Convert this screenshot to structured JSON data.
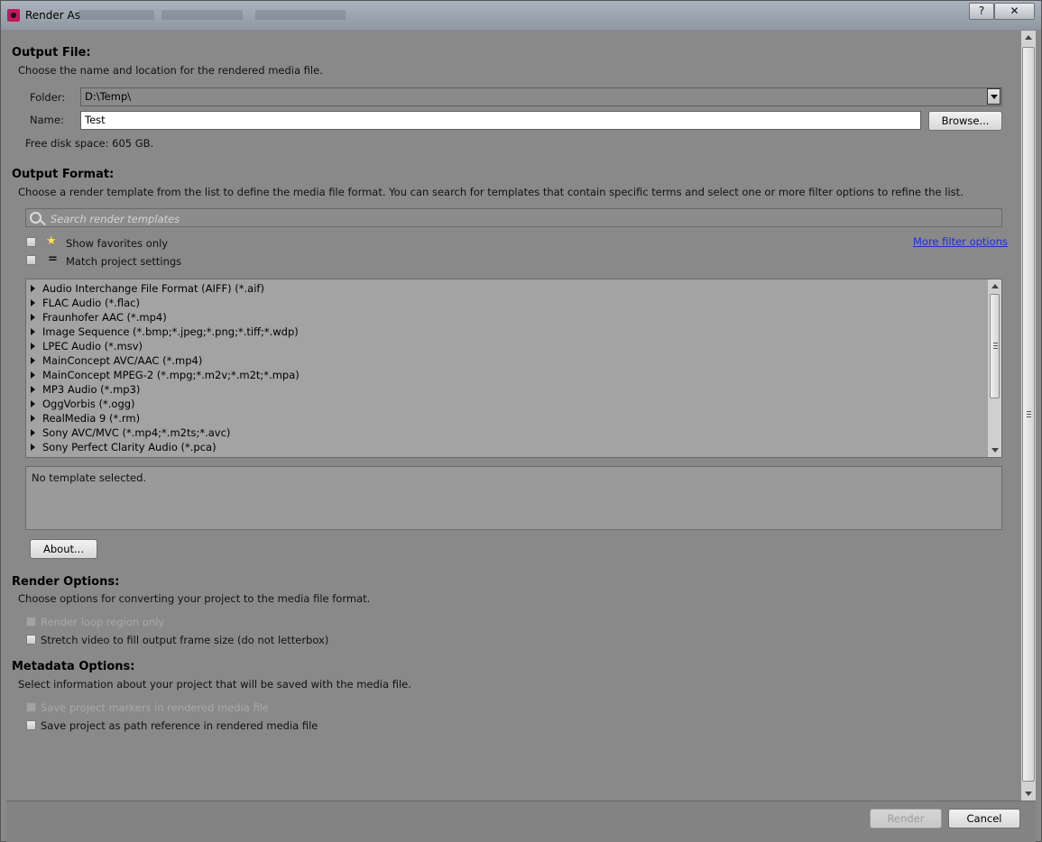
{
  "window": {
    "title": "Render As",
    "help_label": "?",
    "close_label": "✕"
  },
  "output_file": {
    "heading": "Output File:",
    "description": "Choose the name and location for the rendered media file.",
    "folder_label": "Folder:",
    "folder_value": "D:\\Temp\\",
    "name_label": "Name:",
    "name_value": "Test",
    "browse_label": "Browse...",
    "disk_space": "Free disk space: 605 GB."
  },
  "output_format": {
    "heading": "Output Format:",
    "description": "Choose a render template from the list to define the media file format. You can search for templates that contain specific terms and select one or more filter options to refine the list.",
    "search_placeholder": "Search render templates",
    "show_favorites_label": "Show favorites only",
    "match_project_label": "Match project settings",
    "more_filter_label": "More filter options",
    "templates": [
      "Audio Interchange File Format (AIFF) (*.aif)",
      "FLAC Audio (*.flac)",
      "Fraunhofer AAC (*.mp4)",
      "Image Sequence (*.bmp;*.jpeg;*.png;*.tiff;*.wdp)",
      "LPEC Audio (*.msv)",
      "MainConcept AVC/AAC (*.mp4)",
      "MainConcept MPEG-2 (*.mpg;*.m2v;*.m2t;*.mpa)",
      "MP3 Audio (*.mp3)",
      "OggVorbis (*.ogg)",
      "RealMedia 9 (*.rm)",
      "Sony AVC/MVC (*.mp4;*.m2ts;*.avc)",
      "Sony Perfect Clarity Audio (*.pca)"
    ],
    "info_text": "No template selected.",
    "about_label": "About..."
  },
  "render_options": {
    "heading": "Render Options:",
    "description": "Choose options for converting your project to the media file format.",
    "loop_region_label": "Render loop region only",
    "stretch_video_label": "Stretch video to fill output frame size (do not letterbox)"
  },
  "metadata_options": {
    "heading": "Metadata Options:",
    "description": "Select information about your project that will be saved with the media file.",
    "save_markers_label": "Save project markers in rendered media file",
    "save_path_label": "Save project as path reference in rendered media file"
  },
  "footer": {
    "render_label": "Render",
    "cancel_label": "Cancel"
  },
  "icons": {
    "app": "app-icon",
    "search": "search-icon",
    "favorites": "star-icon",
    "match": "equals-icon",
    "dropdown": "chevron-down-icon"
  },
  "colors": {
    "panel_bg": "#898989",
    "link": "#1c2fd6",
    "star": "#ffe25b"
  }
}
